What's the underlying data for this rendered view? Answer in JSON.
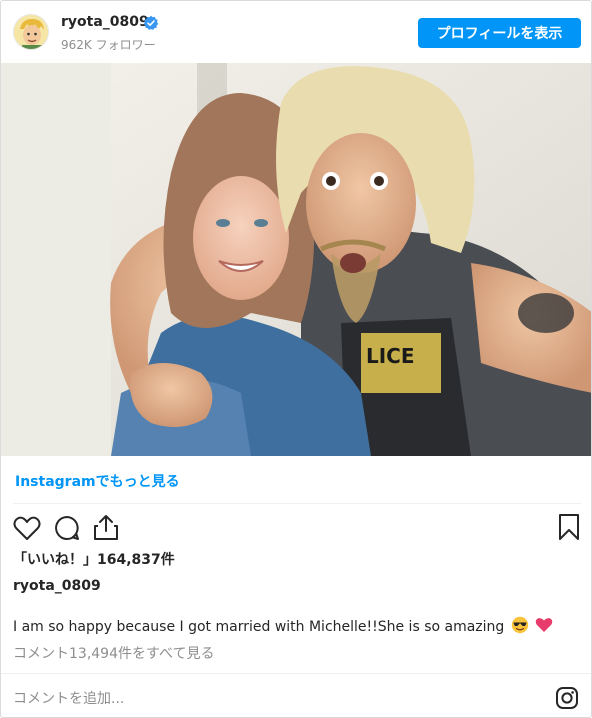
{
  "header": {
    "username": "ryota_0809",
    "followers": "962K フォロワー",
    "profile_button": "プロフィールを表示"
  },
  "post": {
    "more_link": "Instagramでもっと見る",
    "likes": "「いいね！」164,837件",
    "username": "ryota_0809",
    "caption": "I am so happy because I got married with Michelle!!She is so amazing",
    "comments_link": "コメント13,494件をすべて見る",
    "add_comment_placeholder": "コメントを追加..."
  },
  "icons": [
    "verified-badge-icon",
    "heart-icon",
    "comment-icon",
    "share-icon",
    "bookmark-icon",
    "sunglasses-emoji-icon",
    "heart-emoji-icon",
    "instagram-logo-icon"
  ],
  "colors": {
    "accent": "#0095f6",
    "text": "#262626",
    "muted": "#8e8e8e"
  }
}
